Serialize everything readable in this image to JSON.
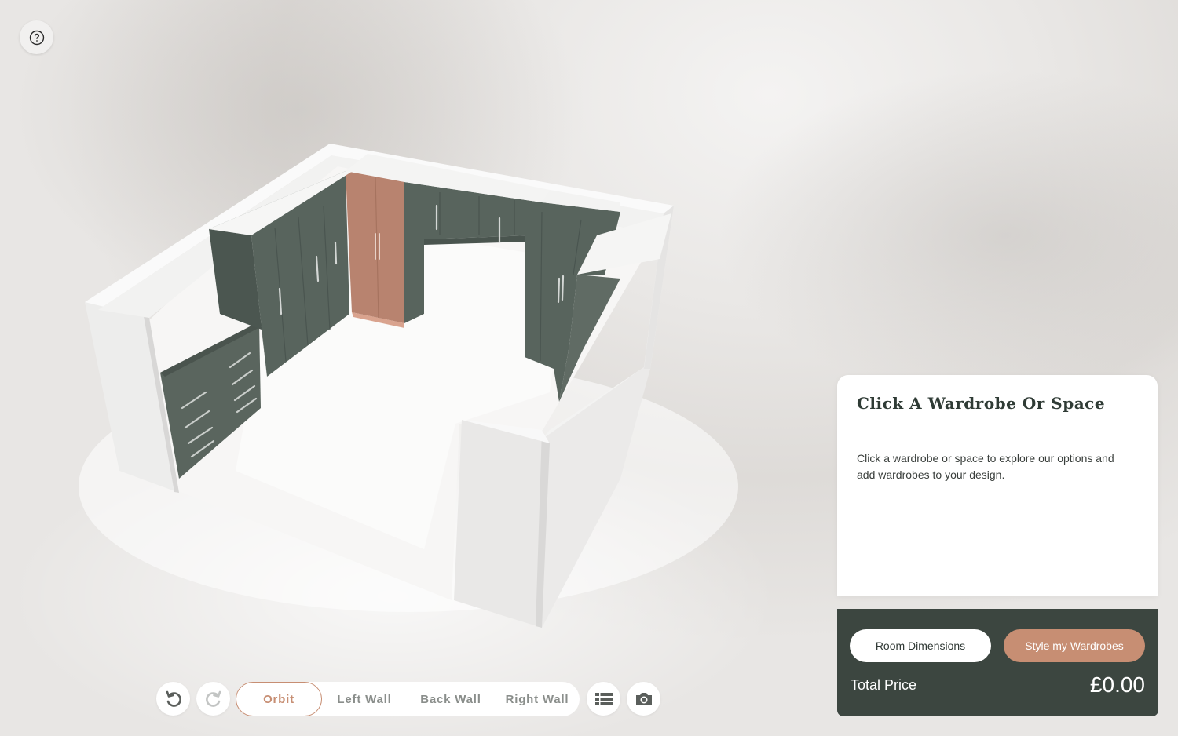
{
  "help": {
    "icon": "question-circle-icon"
  },
  "panel": {
    "title": "Click A Wardrobe Or Space",
    "description": "Click a wardrobe or space to explore our options and add wardrobes to your design."
  },
  "price_panel": {
    "room_dimensions_label": "Room Dimensions",
    "style_label": "Style my Wardrobes",
    "total_label": "Total Price",
    "total_value": "£0.00"
  },
  "toolbar": {
    "undo_icon": "undo-icon",
    "redo_icon": "redo-icon",
    "views": [
      "Orbit",
      "Left Wall",
      "Back Wall",
      "Right Wall"
    ],
    "active_view": "Orbit",
    "list_icon": "list-icon",
    "camera_icon": "camera-icon"
  },
  "colors": {
    "wardrobe_green": "#58645d",
    "accent_copper": "#c78e73",
    "panel_dark": "#3c4640",
    "selected_wardrobe": "#b8836f"
  }
}
